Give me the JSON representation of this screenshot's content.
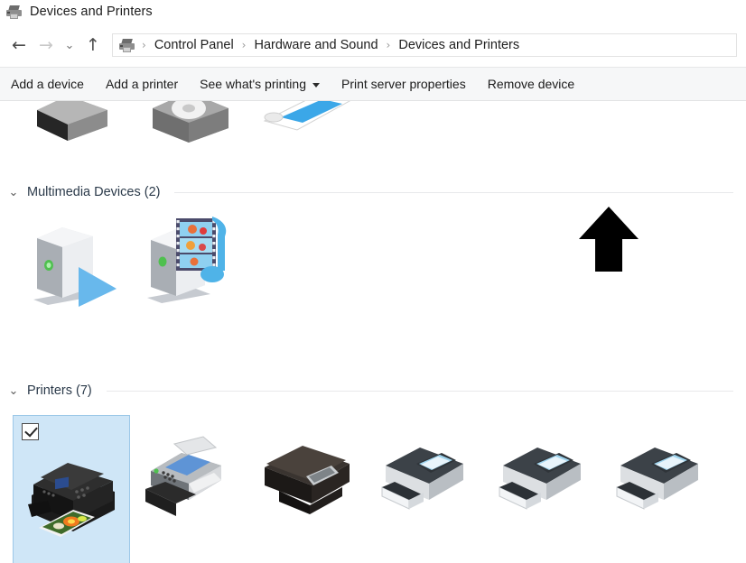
{
  "window": {
    "title": "Devices and Printers",
    "title_icon": "devices-printers-icon"
  },
  "nav": {
    "back_icon": "←",
    "forward_icon": "→",
    "recent_icon": "⌄",
    "up_icon": "↑",
    "address_icon": "devices-printers-icon",
    "breadcrumbs": [
      {
        "label": "Control Panel"
      },
      {
        "label": "Hardware and Sound"
      },
      {
        "label": "Devices and Printers"
      }
    ],
    "separator": "›"
  },
  "toolbar": {
    "items": [
      {
        "label": "Add a device",
        "has_caret": false
      },
      {
        "label": "Add a printer",
        "has_caret": false
      },
      {
        "label": "See what's printing",
        "has_caret": true
      },
      {
        "label": "Print server properties",
        "has_caret": false
      },
      {
        "label": "Remove device",
        "has_caret": false
      }
    ]
  },
  "groups": [
    {
      "chevron": "⌄",
      "title": "Multimedia Devices (2)",
      "devices": [
        {
          "icon": "media-renderer-tower-icon",
          "selected": false
        },
        {
          "icon": "media-server-tower-icon",
          "selected": false
        }
      ]
    },
    {
      "chevron": "⌄",
      "title": "Printers (7)",
      "devices": [
        {
          "icon": "inkjet-photo-printer-icon",
          "selected": true,
          "checkbox": "checked"
        },
        {
          "icon": "fax-multifunction-printer-icon",
          "selected": false
        },
        {
          "icon": "flatbed-allinone-printer-icon",
          "selected": false
        },
        {
          "icon": "generic-printer-icon",
          "selected": false
        },
        {
          "icon": "generic-printer-icon",
          "selected": false
        },
        {
          "icon": "generic-printer-icon",
          "selected": false
        }
      ]
    }
  ],
  "cropped_top_row": {
    "devices": [
      {
        "icon": "dark-box-device-icon"
      },
      {
        "icon": "gray-disc-device-icon"
      },
      {
        "icon": "blue-white-device-icon"
      }
    ]
  },
  "annotation": {
    "arrow": "black-up-arrow-annotation",
    "color": "#000000"
  },
  "colors": {
    "selection_fill": "#cfe6f7",
    "selection_border": "#9cc8e8",
    "toolbar_bg": "#f6f7f8",
    "group_title": "#2b3a4a",
    "rule": "#e8e9eb"
  }
}
